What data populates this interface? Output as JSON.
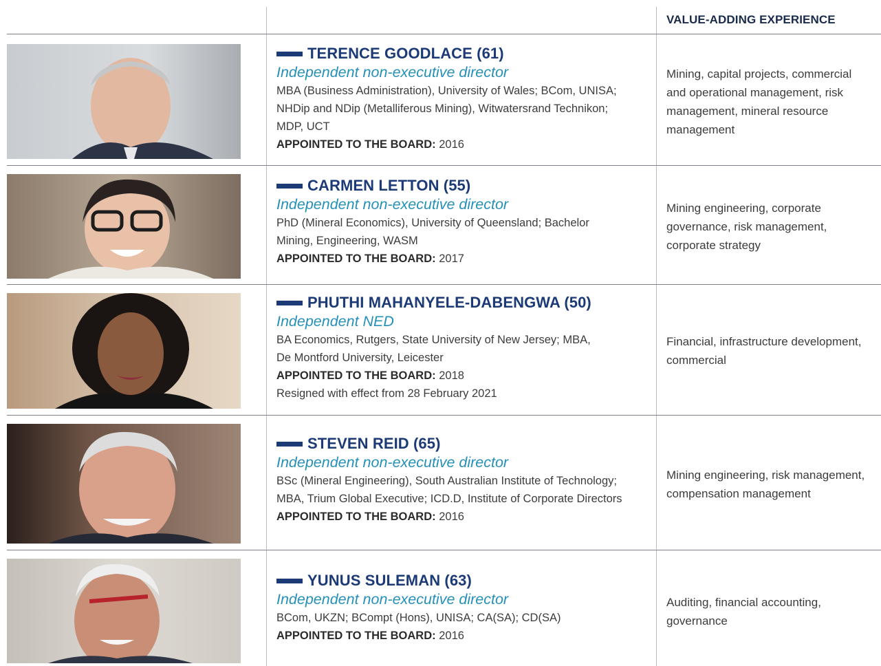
{
  "header": {
    "experience_heading": "VALUE-ADDING EXPERIENCE"
  },
  "appointed_label": "APPOINTED TO THE BOARD:",
  "directors": [
    {
      "name": "TERENCE GOODLACE (61)",
      "role": "Independent non-executive director",
      "qualifications": [
        "MBA (Business Administration), University of Wales; BCom, UNISA;",
        "NHDip and NDip (Metalliferous Mining), Witwatersrand Technikon;",
        "MDP, UCT"
      ],
      "appointed": "2016",
      "note": "",
      "experience": [
        "Mining, capital projects, commercial",
        "and operational management, risk",
        "management, mineral resource",
        "management"
      ],
      "photo_tone": "#9aa0a6"
    },
    {
      "name": "CARMEN LETTON (55)",
      "role": "Independent non-executive director",
      "qualifications": [
        "PhD (Mineral Economics), University of Queensland; Bachelor",
        "Mining, Engineering, WASM"
      ],
      "appointed": "2017",
      "note": "",
      "experience": [
        "Mining engineering, corporate",
        "governance, risk management,",
        "corporate strategy"
      ],
      "photo_tone": "#8a7a6a"
    },
    {
      "name": "PHUTHI MAHANYELE-DABENGWA (50)",
      "role": "Independent NED",
      "qualifications": [
        "BA Economics, Rutgers, State University of New Jersey; MBA,",
        "De Montford University, Leicester"
      ],
      "appointed": "2018",
      "note": "Resigned with effect from 28 February 2021",
      "experience": [
        "Financial, infrastructure development,",
        "commercial"
      ],
      "photo_tone": "#c9a27e"
    },
    {
      "name": "STEVEN REID (65)",
      "role": "Independent non-executive director",
      "qualifications": [
        "BSc (Mineral Engineering), South Australian Institute of Technology;",
        "MBA, Trium Global Executive; ICD.D, Institute of Corporate Directors"
      ],
      "appointed": "2016",
      "note": "",
      "experience": [
        "Mining engineering, risk management,",
        "compensation management"
      ],
      "photo_tone": "#5a4a40"
    },
    {
      "name": "YUNUS SULEMAN (63)",
      "role": "Independent non-executive director",
      "qualifications": [
        "BCom, UKZN; BCompt (Hons), UNISA; CA(SA); CD(SA)"
      ],
      "appointed": "2016",
      "note": "",
      "experience": [
        "Auditing, financial accounting,",
        "governance"
      ],
      "photo_tone": "#b7b2aa"
    }
  ]
}
